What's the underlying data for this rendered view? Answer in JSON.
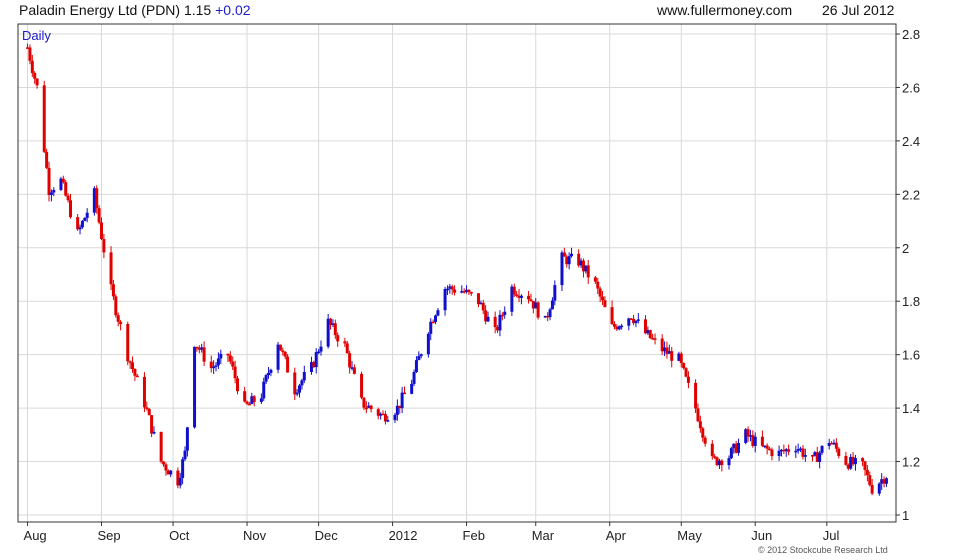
{
  "header": {
    "title": "Paladin Energy Ltd (PDN) 1.15",
    "change": "+0.02",
    "site": "www.fullermoney.com",
    "date": "26 Jul 2012"
  },
  "footer": {
    "copyright": "© 2012 Stockcube Research Ltd"
  },
  "colors": {
    "up": "#1010cc",
    "down": "#e00000",
    "grid": "#d9d9d9",
    "frame": "#333333"
  },
  "chart_data": {
    "type": "line",
    "title": "Paladin Energy Ltd (PDN) 1.15 +0.02",
    "period_label": "Daily",
    "x_tick_labels": [
      "Aug",
      "Sep",
      "Oct",
      "Nov",
      "Dec",
      "2012",
      "Feb",
      "Mar",
      "Apr",
      "May",
      "Jun",
      "Jul"
    ],
    "y_ticks": [
      1,
      1.2,
      1.4,
      1.6,
      1.8,
      2,
      2.2,
      2.4,
      2.6,
      2.8
    ],
    "ylim": [
      1.0,
      2.83
    ],
    "y_axis_side": "right",
    "grid": true,
    "series": [
      {
        "name": "",
        "x": [
          "2011-08-01",
          "2011-08-05",
          "2011-08-10",
          "2011-08-15",
          "2011-08-22",
          "2011-08-29",
          "2011-09-05",
          "2011-09-12",
          "2011-09-19",
          "2011-09-26",
          "2011-10-03",
          "2011-10-06",
          "2011-10-10",
          "2011-10-17",
          "2011-10-24",
          "2011-10-31",
          "2011-11-07",
          "2011-11-14",
          "2011-11-21",
          "2011-11-28",
          "2011-12-05",
          "2011-12-12",
          "2011-12-19",
          "2011-12-28",
          "2012-01-03",
          "2012-01-09",
          "2012-01-16",
          "2012-01-23",
          "2012-01-30",
          "2012-02-06",
          "2012-02-13",
          "2012-02-20",
          "2012-02-27",
          "2012-03-05",
          "2012-03-12",
          "2012-03-19",
          "2012-03-26",
          "2012-04-02",
          "2012-04-10",
          "2012-04-16",
          "2012-04-23",
          "2012-04-30",
          "2012-05-07",
          "2012-05-14",
          "2012-05-21",
          "2012-05-28",
          "2012-06-04",
          "2012-06-11",
          "2012-06-18",
          "2012-06-25",
          "2012-07-02",
          "2012-07-09",
          "2012-07-16",
          "2012-07-20",
          "2012-07-26"
        ],
        "y": [
          2.75,
          2.6,
          2.22,
          2.25,
          2.05,
          2.2,
          1.84,
          1.6,
          1.42,
          1.2,
          1.13,
          1.23,
          1.65,
          1.55,
          1.6,
          1.4,
          1.45,
          1.65,
          1.47,
          1.55,
          1.72,
          1.63,
          1.42,
          1.37,
          1.4,
          1.5,
          1.7,
          1.85,
          1.84,
          1.8,
          1.68,
          1.85,
          1.82,
          1.72,
          1.96,
          1.95,
          1.86,
          1.7,
          1.75,
          1.68,
          1.62,
          1.58,
          1.4,
          1.2,
          1.22,
          1.3,
          1.25,
          1.23,
          1.26,
          1.2,
          1.28,
          1.2,
          1.18,
          1.1,
          1.15
        ]
      }
    ]
  }
}
